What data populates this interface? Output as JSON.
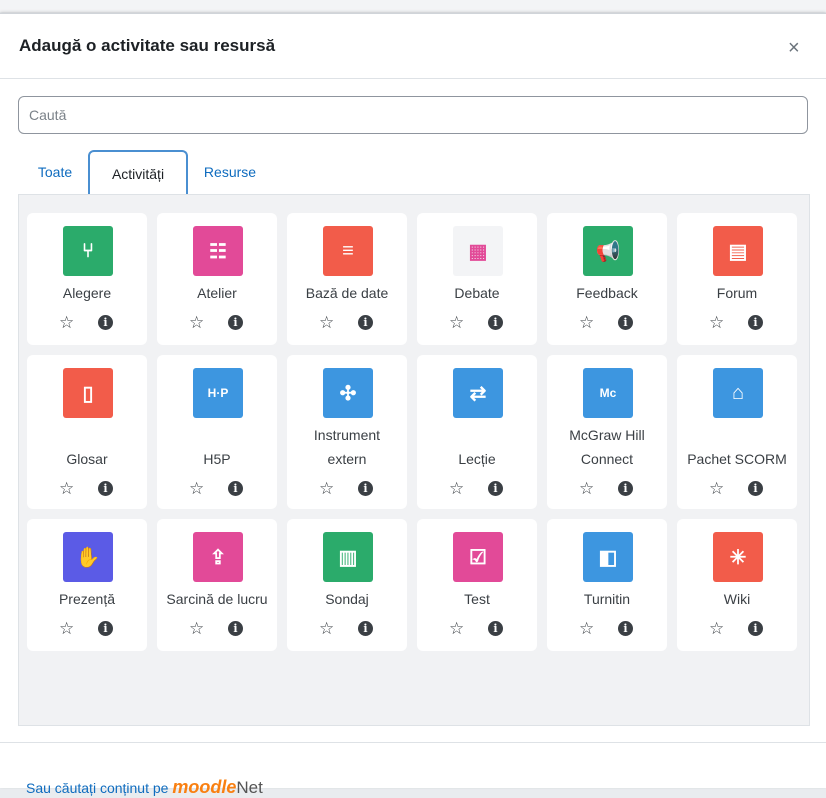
{
  "dialog": {
    "title": "Adaugă o activitate sau resursă",
    "close": "×"
  },
  "search": {
    "placeholder": "Caută"
  },
  "tabs": [
    "Toate",
    "Activități",
    "Resurse"
  ],
  "activities": [
    {
      "name": "Alegere",
      "color": "#2bab6b"
    },
    {
      "name": "Atelier",
      "color": "#e24a98"
    },
    {
      "name": "Bază de date",
      "color": "#f25c4a"
    },
    {
      "name": "Debate",
      "color": "#f3f4f6"
    },
    {
      "name": "Feedback",
      "color": "#2bab6b"
    },
    {
      "name": "Forum",
      "color": "#f25c4a"
    },
    {
      "name": "Glosar",
      "color": "#f25c4a"
    },
    {
      "name": "H5P",
      "color": "#3d96e0"
    },
    {
      "name": "Instrument extern",
      "color": "#3d96e0"
    },
    {
      "name": "Lecție",
      "color": "#3d96e0"
    },
    {
      "name": "McGraw Hill Connect",
      "color": "#3d96e0"
    },
    {
      "name": "Pachet SCORM",
      "color": "#3d96e0"
    },
    {
      "name": "Prezență",
      "color": "#5b5be6"
    },
    {
      "name": "Sarcină de lucru",
      "color": "#e24a98"
    },
    {
      "name": "Sondaj",
      "color": "#2bab6b"
    },
    {
      "name": "Test",
      "color": "#e24a98"
    },
    {
      "name": "Turnitin",
      "color": "#3d96e0"
    },
    {
      "name": "Wiki",
      "color": "#f25c4a"
    }
  ],
  "action_icons": {
    "star": "☆",
    "info": "i"
  },
  "footer": {
    "prefix": "Sau căutați conținut pe",
    "brand_a": "moodle",
    "brand_b": "Net"
  },
  "icons": [
    "choice-icon",
    "workshop-icon",
    "database-icon",
    "debate-icon",
    "feedback-icon",
    "forum-icon",
    "glossary-icon",
    "h5p-icon",
    "external-tool-icon",
    "lesson-icon",
    "mcgraw-icon",
    "scorm-icon",
    "attendance-icon",
    "assignment-icon",
    "survey-icon",
    "quiz-icon",
    "turnitin-icon",
    "wiki-icon"
  ]
}
